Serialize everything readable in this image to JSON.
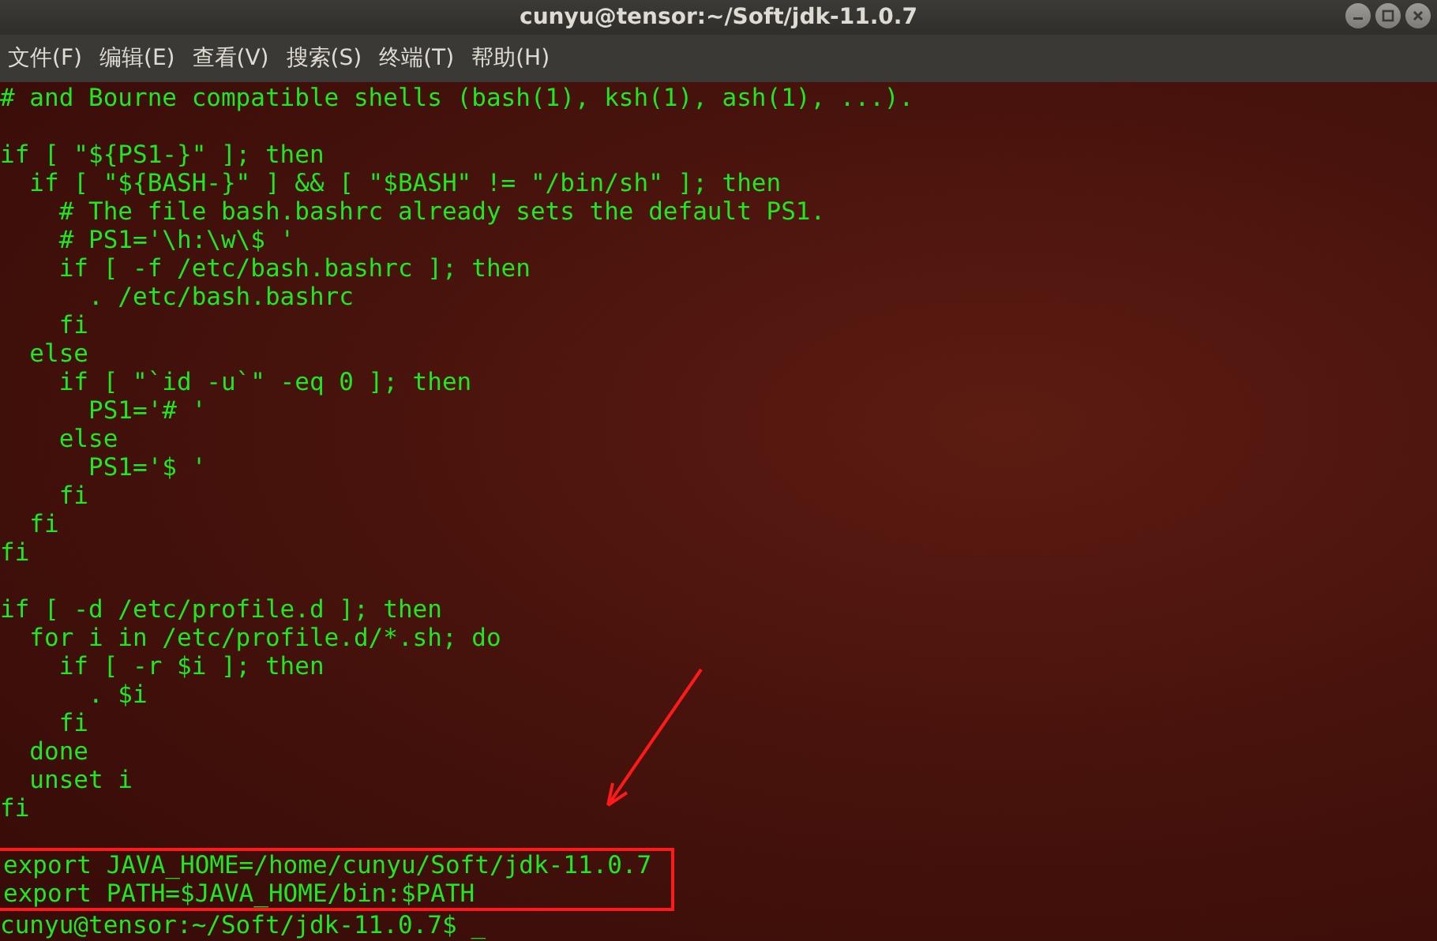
{
  "window": {
    "title": "cunyu@tensor:~/Soft/jdk-11.0.7"
  },
  "menu": [
    "文件(F)",
    "编辑(E)",
    "查看(V)",
    "搜索(S)",
    "终端(T)",
    "帮助(H)"
  ],
  "terminal": {
    "blocks": [
      {
        "highlighted": false,
        "lines": [
          "# and Bourne compatible shells (bash(1), ksh(1), ash(1), ...)."
        ]
      },
      {
        "highlighted": false,
        "lines": [
          "if [ \"${PS1-}\" ]; then",
          "  if [ \"${BASH-}\" ] && [ \"$BASH\" != \"/bin/sh\" ]; then",
          "    # The file bash.bashrc already sets the default PS1.",
          "    # PS1='\\h:\\w\\$ '",
          "    if [ -f /etc/bash.bashrc ]; then",
          "      . /etc/bash.bashrc",
          "    fi",
          "  else",
          "    if [ \"`id -u`\" -eq 0 ]; then",
          "      PS1='# '",
          "    else",
          "      PS1='$ '",
          "    fi",
          "  fi",
          "fi"
        ]
      },
      {
        "highlighted": false,
        "lines": [
          "if [ -d /etc/profile.d ]; then",
          "  for i in /etc/profile.d/*.sh; do",
          "    if [ -r $i ]; then",
          "      . $i",
          "    fi",
          "  done",
          "  unset i",
          "fi"
        ]
      },
      {
        "highlighted": true,
        "lines": [
          "export JAVA_HOME=/home/cunyu/Soft/jdk-11.0.7",
          "export PATH=$JAVA_HOME/bin:$PATH"
        ]
      }
    ],
    "prompt": {
      "text": "cunyu@tensor:~/Soft/jdk-11.0.7$",
      "cursor": "_"
    }
  }
}
